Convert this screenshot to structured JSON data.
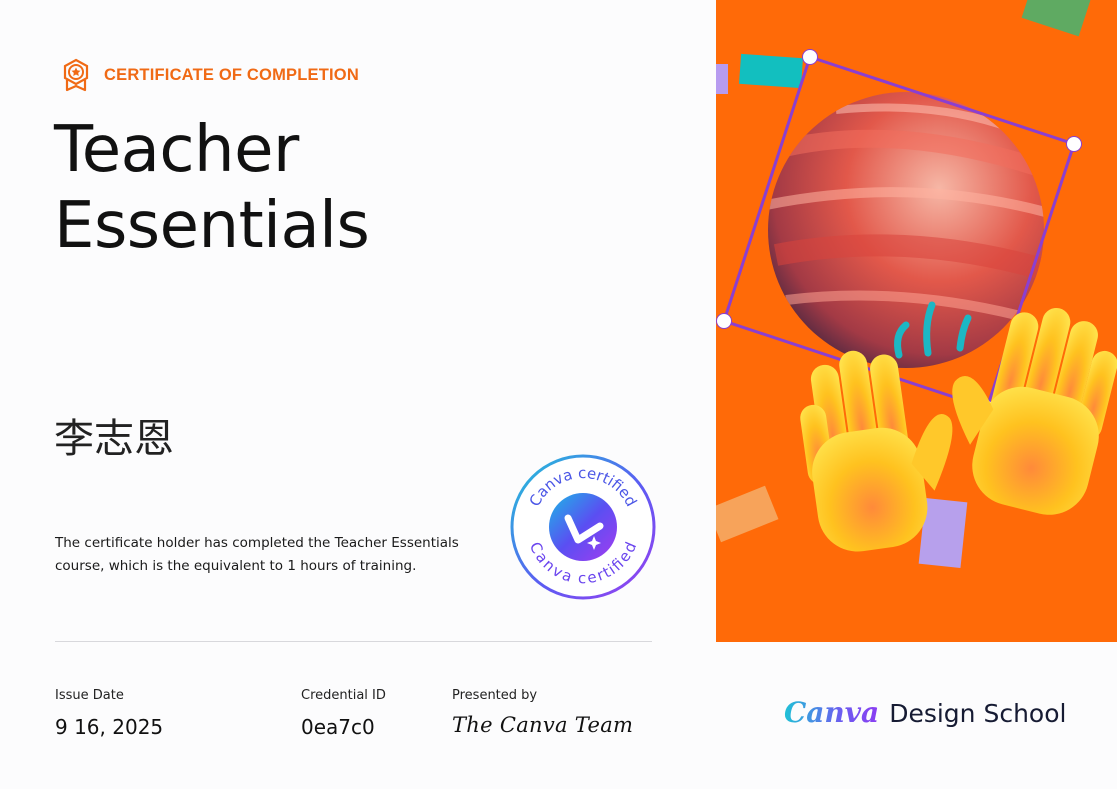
{
  "header": {
    "label": "CERTIFICATE OF COMPLETION",
    "icon": "award-badge-icon",
    "accent_color": "#f06a15"
  },
  "course": {
    "title_line1": "Teacher",
    "title_line2": "Essentials"
  },
  "holder": {
    "name": "李志恩"
  },
  "description": {
    "line1": "The certificate holder has completed the Teacher Essentials",
    "line2": "course, which is the equivalent to 1 hours of training."
  },
  "seal": {
    "text": "Canva certified",
    "icon": "canva-check-icon"
  },
  "footer": {
    "issue_date_label": "Issue Date",
    "issue_date": "9 16, 2025",
    "credential_label": "Credential ID",
    "credential_id": "0ea7c0",
    "presented_label": "Presented by",
    "presenter": "The Canva Team"
  },
  "brand": {
    "canva": "Canva",
    "school": "Design School"
  },
  "artwork": {
    "background_color": "#ff6a08",
    "description_icons": [
      "planet-icon",
      "raised-hands-icon"
    ]
  }
}
